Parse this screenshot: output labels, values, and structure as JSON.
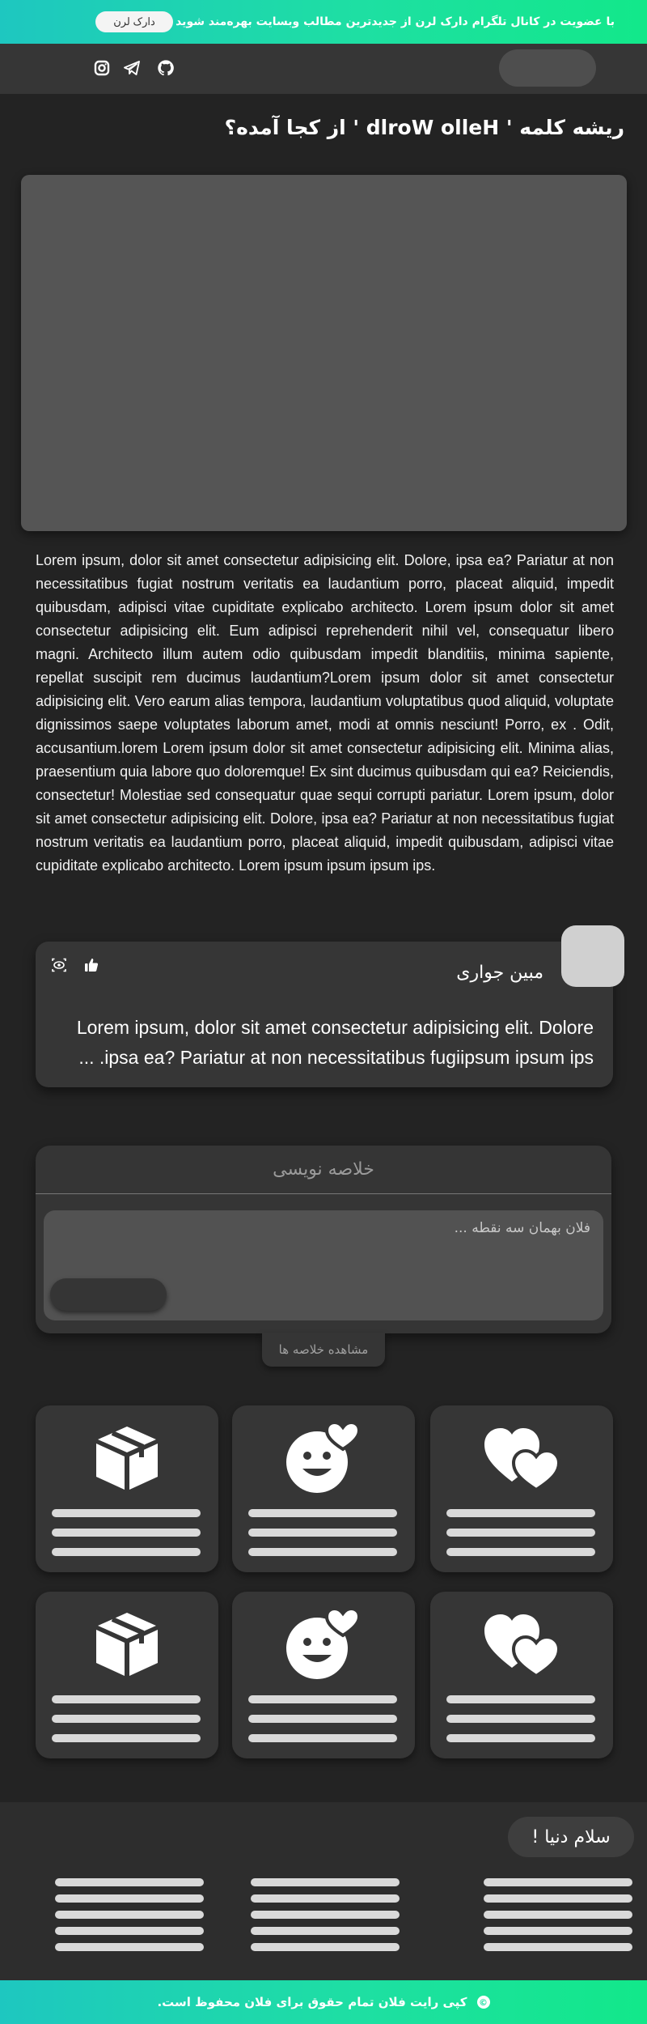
{
  "promo": {
    "text": "با عضویت در کانال تلگرام دارک لرن از جدیدترین مطالب وبسایت بهره‌مند شوید",
    "button_label": "دارک لرن"
  },
  "nav": {
    "social_icons": [
      "github-icon",
      "telegram-icon",
      "instagram-icon"
    ]
  },
  "article": {
    "title": "ریشه کلمه ' dlroW olleH ' از کجا آمده؟",
    "body": "Lorem ipsum, dolor sit amet consectetur adipisicing elit. Dolore, ipsa ea? Pariatur at non necessitatibus fugiat nostrum veritatis ea laudantium porro, placeat aliquid, impedit quibusdam, adipisci vitae cupiditate explicabo architecto. Lorem ipsum dolor sit amet consectetur adipisicing elit. Eum adipisci reprehenderit nihil vel, consequatur libero magni. Architecto illum autem odio quibusdam impedit blanditiis, minima sapiente, repellat suscipit rem ducimus laudantium?Lorem ipsum dolor sit amet consectetur adipisicing elit. Vero earum alias tempora, laudantium voluptatibus quod aliquid, voluptate dignissimos saepe voluptates laborum amet, modi at omnis nesciunt! Porro, ex . Odit, accusantium.lorem Lorem ipsum dolor sit amet consectetur adipisicing elit. Minima alias, praesentium quia labore quo doloremque! Ex sint ducimus quibusdam qui ea? Reiciendis, consectetur! Molestiae sed consequatur quae sequi corrupti pariatur. Lorem ipsum, dolor sit amet consectetur adipisicing elit. Dolore, ipsa ea? Pariatur at non necessitatibus fugiat nostrum veritatis ea laudantium porro, placeat aliquid, impedit quibusdam, adipisci vitae cupiditate explicabo architecto. Lorem ipsum ipsum ipsum ips."
  },
  "comment": {
    "author": "مبین جواری",
    "text": "Lorem ipsum, dolor sit amet consectetur adipisicing elit. Dolore ipsa ea? Pariatur at non necessitatibus fugiipsum ipsum ips. ..."
  },
  "summary": {
    "heading": "خلاصه نویسی",
    "placeholder": "فلان بهمان سه نقطه ...",
    "view_label": "مشاهده خلاصه ها"
  },
  "cards": [
    {
      "icon": "hearts-icon"
    },
    {
      "icon": "smiley-heart-icon"
    },
    {
      "icon": "box-icon"
    },
    {
      "icon": "hearts-icon"
    },
    {
      "icon": "smiley-heart-icon"
    },
    {
      "icon": "box-icon"
    }
  ],
  "footer": {
    "greeting": "سلام دنیا !",
    "copyright": "کپی رایت فلان تمام حقوق برای فلان محفوظ است."
  },
  "colors": {
    "accent_gradient_start": "#1ec7c0",
    "accent_gradient_end": "#12e88a",
    "background": "#232323",
    "card": "#363636"
  }
}
